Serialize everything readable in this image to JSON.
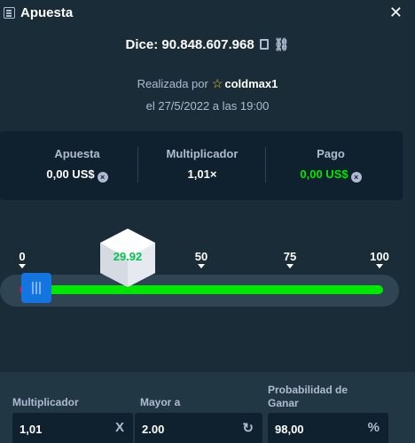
{
  "header": {
    "title": "Apuesta",
    "close_glyph": "✕"
  },
  "bet": {
    "label": "Dice: 90.848.607.968",
    "placed_by_prefix": "Realizada por",
    "user": "coldmax1",
    "date": "el 27/5/2022 a las 19:00"
  },
  "summary": {
    "bet_label": "Apuesta",
    "bet_value": "0,00 US$",
    "multiplier_label": "Multiplicador",
    "multiplier_value": "1,01×",
    "payout_label": "Pago",
    "payout_value": "0,00 US$"
  },
  "slider": {
    "ticks": [
      "0",
      "50",
      "75",
      "100"
    ],
    "result": "29.92"
  },
  "fields": {
    "multiplier_label": "Multiplicador",
    "multiplier_value": "1,01",
    "multiplier_suffix": "X",
    "roll_over_label": "Mayor a",
    "roll_over_value": "2.00",
    "roll_over_suffix": "↻",
    "win_chance_label_1": "Probabilidad de",
    "win_chance_label_2": "Ganar",
    "win_chance_value": "98,00",
    "win_chance_suffix": "%"
  },
  "icons": {
    "list": "list-icon",
    "copy": "copy-icon",
    "link": "link-icon",
    "star": "star-icon",
    "currency": "currency-icon",
    "swap": "swap-icon"
  },
  "colors": {
    "background": "#1a2c38",
    "panel": "#0f212e",
    "track": "#2f4553",
    "win": "#00e701",
    "lose": "#e9113c",
    "handle": "#1475e1",
    "star": "#f5c518"
  }
}
